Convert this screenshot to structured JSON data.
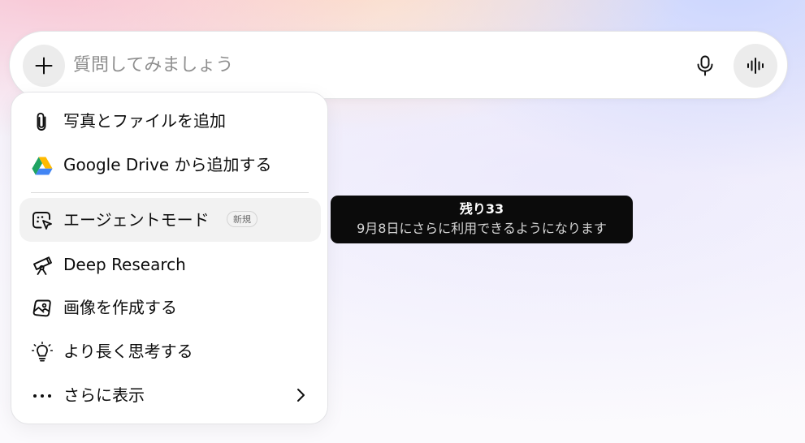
{
  "composer": {
    "plus_icon": "plus-icon",
    "placeholder": "質問してみましょう",
    "value": "",
    "mic_icon": "microphone-icon",
    "voice_icon": "voice-mode-waveform-icon"
  },
  "menu": {
    "items": [
      {
        "label": "写真とファイルを追加",
        "icon": "paperclip-icon"
      },
      {
        "label": "Google Drive から追加する",
        "icon": "google-drive-icon"
      },
      {
        "label": "エージェントモード",
        "icon": "agent-cursor-icon",
        "badge": "新規"
      },
      {
        "label": "Deep Research",
        "icon": "telescope-icon"
      },
      {
        "label": "画像を作成する",
        "icon": "image-create-icon"
      },
      {
        "label": "より長く思考する",
        "icon": "lightbulb-icon"
      },
      {
        "label": "さらに表示",
        "icon": "more-dots-icon",
        "chevron": "chevron-right-icon"
      }
    ]
  },
  "tooltip": {
    "title": "残り33",
    "subtitle": "9月8日にさらに利用できるようになります"
  },
  "colors": {
    "tooltip_bg": "#0b0b0b",
    "button_bg": "#ececec",
    "active_row_bg": "#f2f2f2",
    "drive_green": "#1ea362",
    "drive_yellow": "#ffba00",
    "drive_blue": "#4285f4"
  }
}
